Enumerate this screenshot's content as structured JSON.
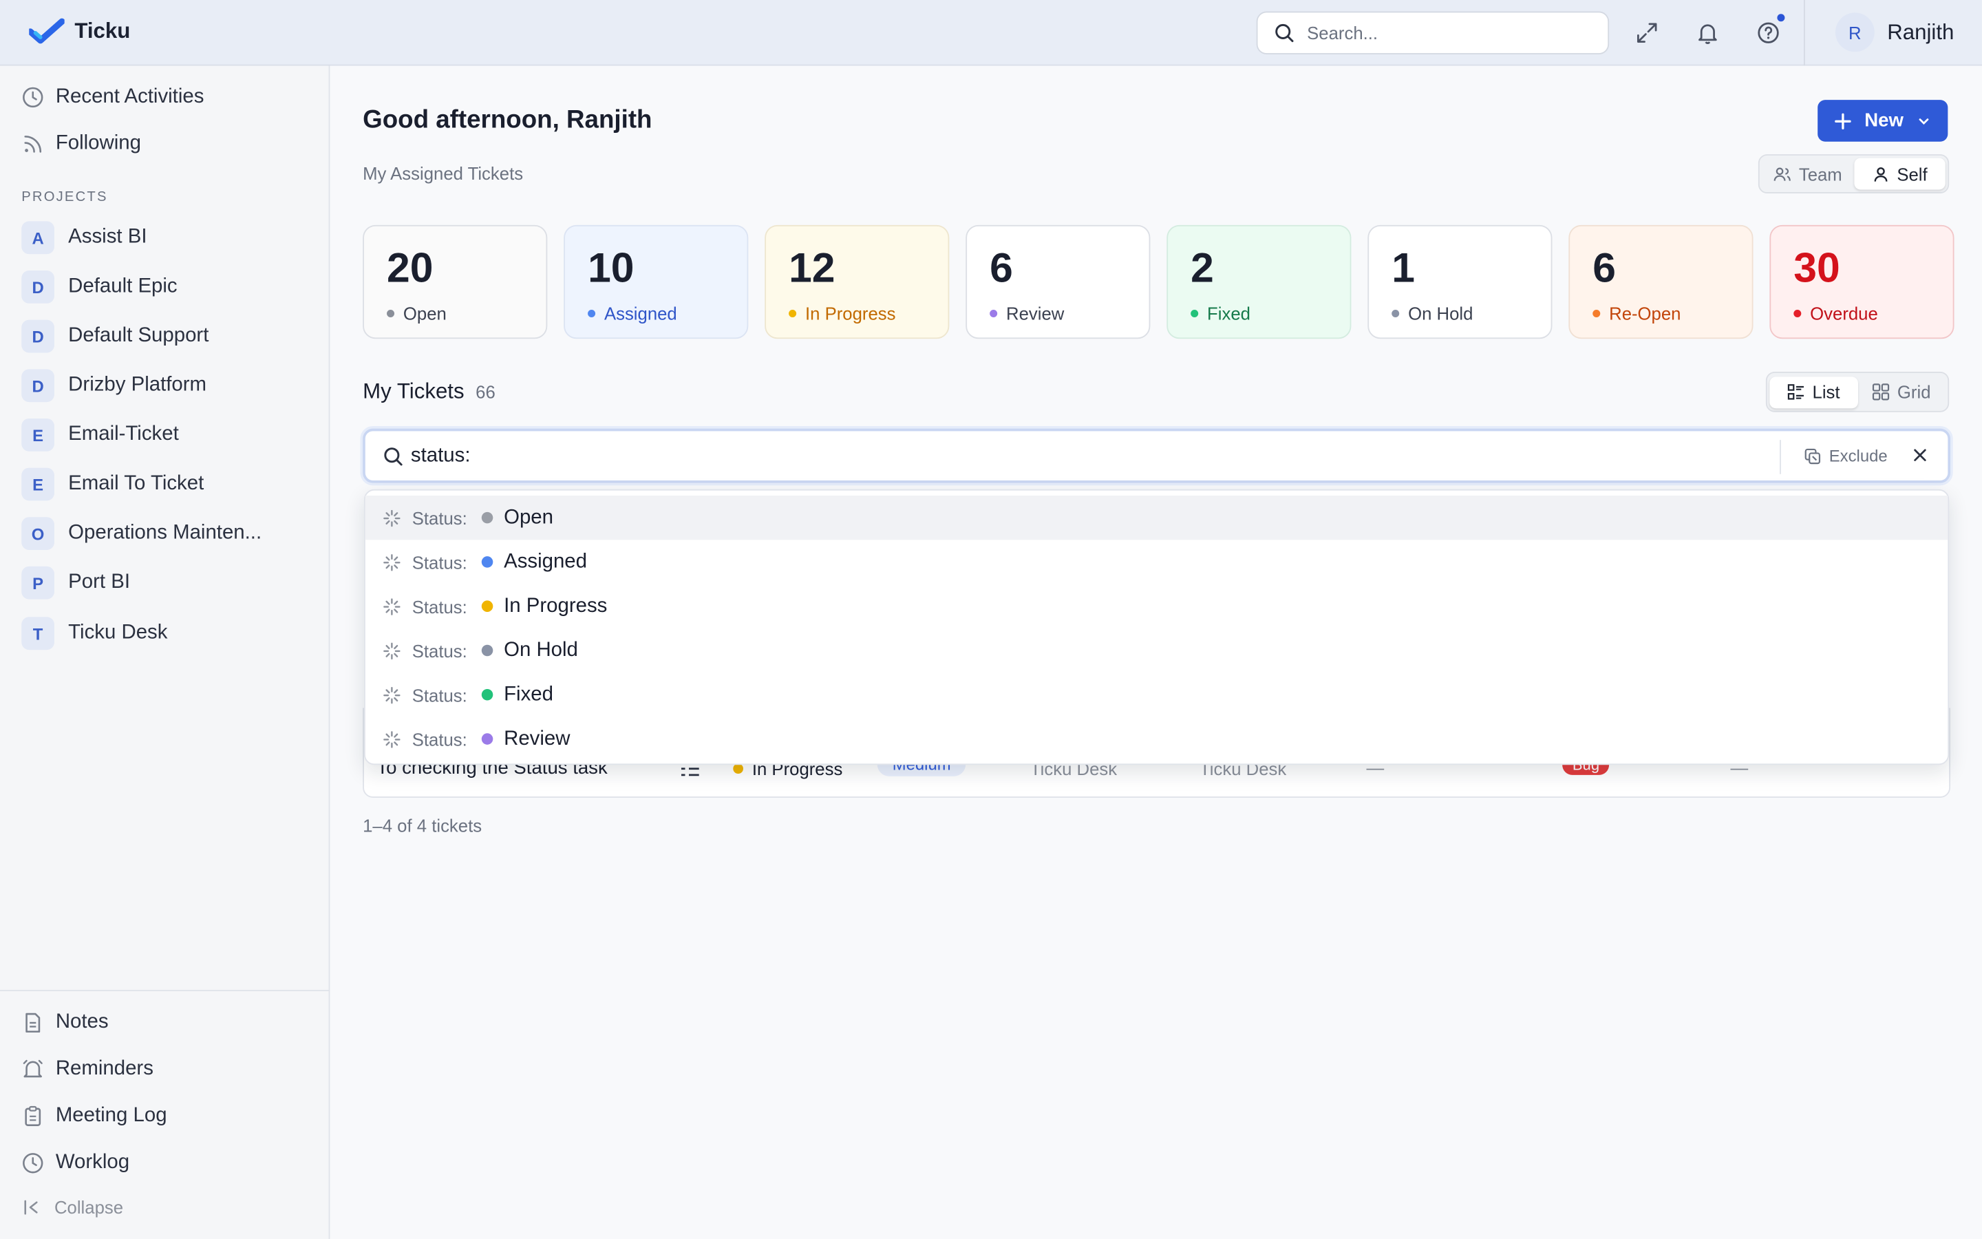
{
  "brand": {
    "name": "Ticku",
    "accent": "#2f5ad7"
  },
  "header": {
    "search_placeholder": "Search...",
    "user_initial": "R",
    "user_name": "Ranjith"
  },
  "sidebar": {
    "top_items": [
      {
        "label": "Recent Activities",
        "icon": "clock-icon"
      },
      {
        "label": "Following",
        "icon": "rss-icon"
      }
    ],
    "projects_heading": "PROJECTS",
    "projects": [
      {
        "initial": "A",
        "label": "Assist BI"
      },
      {
        "initial": "D",
        "label": "Default Epic"
      },
      {
        "initial": "D",
        "label": "Default Support"
      },
      {
        "initial": "D",
        "label": "Drizby Platform"
      },
      {
        "initial": "E",
        "label": "Email-Ticket"
      },
      {
        "initial": "E",
        "label": "Email To Ticket"
      },
      {
        "initial": "O",
        "label": "Operations Mainten..."
      },
      {
        "initial": "P",
        "label": "Port BI"
      },
      {
        "initial": "T",
        "label": "Ticku Desk"
      }
    ],
    "bottom_items": [
      {
        "label": "Notes",
        "icon": "file-icon"
      },
      {
        "label": "Reminders",
        "icon": "bell-icon"
      },
      {
        "label": "Meeting Log",
        "icon": "clipboard-icon"
      },
      {
        "label": "Worklog",
        "icon": "clock-icon"
      }
    ],
    "collapse_label": "Collapse"
  },
  "main": {
    "greeting": "Good afternoon, Ranjith",
    "subtitle": "My Assigned Tickets",
    "new_label": "New",
    "scope": {
      "team": "Team",
      "self": "Self",
      "selected": "Self"
    },
    "stats": [
      {
        "value": "20",
        "label": "Open",
        "dot": "#8a8f99",
        "bg": "#fafafa",
        "border": "#dcdfe5",
        "label_color": "#3b4150",
        "num_color": "#1a1f2e"
      },
      {
        "value": "10",
        "label": "Assigned",
        "dot": "#4f86f0",
        "bg": "#eef4fe",
        "border": "#dce4f3",
        "label_color": "#2f55c8",
        "num_color": "#1a1f2e"
      },
      {
        "value": "12",
        "label": "In Progress",
        "dot": "#f0b400",
        "bg": "#fefaea",
        "border": "#eee6cf",
        "label_color": "#c26a00",
        "num_color": "#1a1f2e"
      },
      {
        "value": "6",
        "label": "Review",
        "dot": "#9b7be8",
        "bg": "#ffffff",
        "border": "#dcdfe5",
        "label_color": "#3b4150",
        "num_color": "#1a1f2e"
      },
      {
        "value": "2",
        "label": "Fixed",
        "dot": "#22c27a",
        "bg": "#ebfbf2",
        "border": "#d4ece0",
        "label_color": "#157a4a",
        "num_color": "#1a1f2e"
      },
      {
        "value": "1",
        "label": "On Hold",
        "dot": "#8a93a6",
        "bg": "#ffffff",
        "border": "#dcdfe5",
        "label_color": "#3b4150",
        "num_color": "#1a1f2e"
      },
      {
        "value": "6",
        "label": "Re-Open",
        "dot": "#f57c2b",
        "bg": "#fff4ec",
        "border": "#f0e0d3",
        "label_color": "#c2450a",
        "num_color": "#1a1f2e"
      },
      {
        "value": "30",
        "label": "Overdue",
        "dot": "#e5202a",
        "bg": "#fff0f0",
        "border": "#f2c6c8",
        "label_color": "#c11119",
        "num_color": "#d4121b"
      }
    ],
    "tickets_title": "My Tickets",
    "tickets_count": "66",
    "view": {
      "list": "List",
      "grid": "Grid",
      "selected": "List"
    },
    "filter_value": "status:",
    "exclude_label": "Exclude",
    "status_options": [
      {
        "key": "Status:",
        "value": "Open",
        "color": "#9a9ea6"
      },
      {
        "key": "Status:",
        "value": "Assigned",
        "color": "#4f86f0"
      },
      {
        "key": "Status:",
        "value": "In Progress",
        "color": "#f0b400"
      },
      {
        "key": "Status:",
        "value": "On Hold",
        "color": "#8a93a6"
      },
      {
        "key": "Status:",
        "value": "Fixed",
        "color": "#22c27a"
      },
      {
        "key": "Status:",
        "value": "Review",
        "color": "#9b7be8"
      }
    ],
    "row": {
      "title": "To checking the Status task",
      "status": "In Progress",
      "priority": "Medium",
      "project": "Ticku Desk",
      "project2": "Ticku Desk",
      "dash": "—",
      "type": "Bug",
      "dash2": "—",
      "more": "···"
    },
    "pagination": "1–4 of 4 tickets"
  }
}
